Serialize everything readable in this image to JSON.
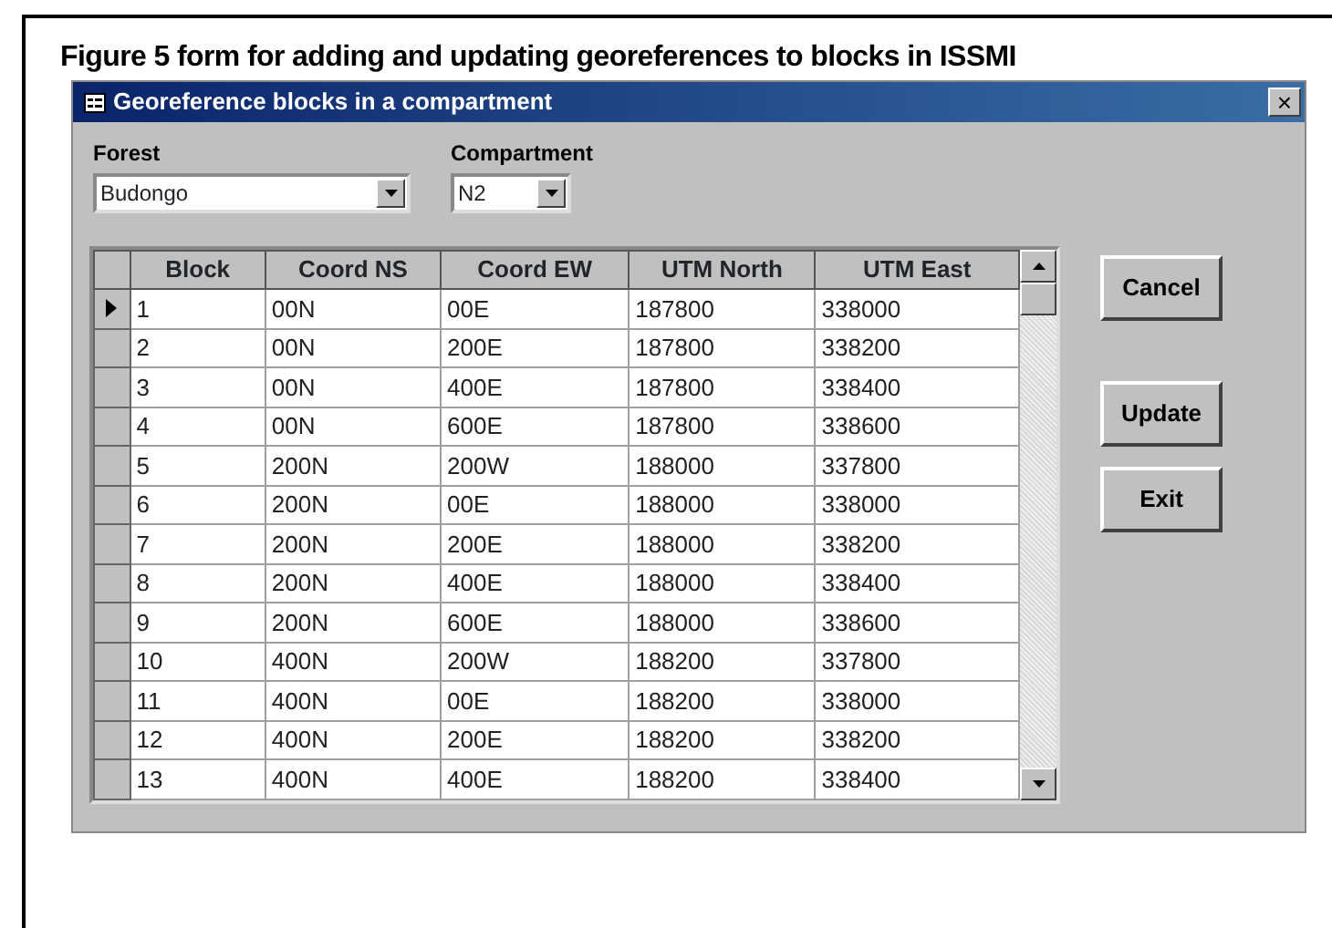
{
  "caption": "Figure 5  form for adding and updating georeferences to blocks in ISSMI",
  "window": {
    "title": "Georeference blocks in a compartment",
    "close": "×"
  },
  "fields": [
    {
      "label": "Forest",
      "value": "Budongo"
    },
    {
      "label": "Compartment",
      "value": "N2"
    }
  ],
  "table": {
    "columns": [
      "Block",
      "Coord NS",
      "Coord EW",
      "UTM North",
      "UTM East"
    ],
    "rows": [
      {
        "selected": true,
        "cells": [
          "1",
          "00N",
          "00E",
          "187800",
          "338000"
        ]
      },
      {
        "selected": false,
        "cells": [
          "2",
          "00N",
          "200E",
          "187800",
          "338200"
        ]
      },
      {
        "selected": false,
        "cells": [
          "3",
          "00N",
          "400E",
          "187800",
          "338400"
        ]
      },
      {
        "selected": false,
        "cells": [
          "4",
          "00N",
          "600E",
          "187800",
          "338600"
        ]
      },
      {
        "selected": false,
        "cells": [
          "5",
          "200N",
          "200W",
          "188000",
          "337800"
        ]
      },
      {
        "selected": false,
        "cells": [
          "6",
          "200N",
          "00E",
          "188000",
          "338000"
        ]
      },
      {
        "selected": false,
        "cells": [
          "7",
          "200N",
          "200E",
          "188000",
          "338200"
        ]
      },
      {
        "selected": false,
        "cells": [
          "8",
          "200N",
          "400E",
          "188000",
          "338400"
        ]
      },
      {
        "selected": false,
        "cells": [
          "9",
          "200N",
          "600E",
          "188000",
          "338600"
        ]
      },
      {
        "selected": false,
        "cells": [
          "10",
          "400N",
          "200W",
          "188200",
          "337800"
        ]
      },
      {
        "selected": false,
        "cells": [
          "11",
          "400N",
          "00E",
          "188200",
          "338000"
        ]
      },
      {
        "selected": false,
        "cells": [
          "12",
          "400N",
          "200E",
          "188200",
          "338200"
        ]
      },
      {
        "selected": false,
        "cells": [
          "13",
          "400N",
          "400E",
          "188200",
          "338400"
        ]
      }
    ]
  },
  "buttons": [
    "Cancel",
    "Update",
    "Exit"
  ]
}
